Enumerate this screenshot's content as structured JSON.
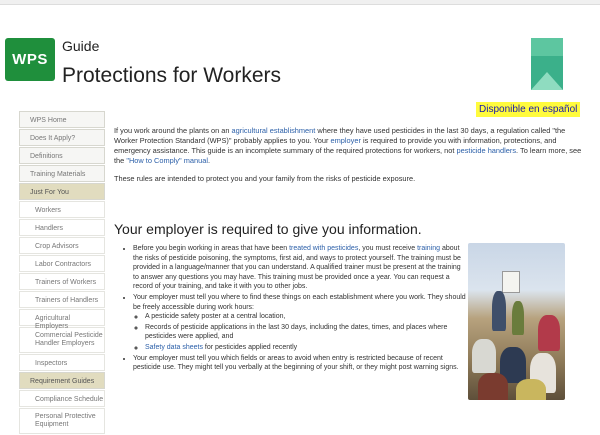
{
  "header": {
    "logo_text": "WPS",
    "guide_label": "Guide",
    "title": "Protections for Workers",
    "spanish_link": "Disponible en español"
  },
  "sidebar": {
    "items": [
      {
        "label": "WPS Home"
      },
      {
        "label": "Does It Apply?"
      },
      {
        "label": "Definitions"
      },
      {
        "label": "Training Materials"
      },
      {
        "label": "Just For You"
      },
      {
        "label": "Workers"
      },
      {
        "label": "Handlers"
      },
      {
        "label": "Crop Advisors"
      },
      {
        "label": "Labor Contractors"
      },
      {
        "label": "Trainers of Workers"
      },
      {
        "label": "Trainers of Handlers"
      },
      {
        "label": "Agricultural Employers"
      },
      {
        "label": "Commercial Pesticide Handler Employers"
      },
      {
        "label": "Inspectors"
      },
      {
        "label": "Requirement Guides"
      },
      {
        "label": "Compliance Schedule"
      },
      {
        "label": "Personal Protective Equipment"
      }
    ]
  },
  "intro": {
    "p1_a": "If you work around the plants on an ",
    "p1_link1": "agricultural establishment",
    "p1_b": " where they have used pesticides in the last 30 days, a regulation called \"the Worker Protection Standard (WPS)\" probably applies to you. Your ",
    "p1_link2": "employer",
    "p1_c": " is required to provide you with information, protections, and emergency assistance. This guide is an incomplete summary of the required protections for workers, not ",
    "p1_link3": "pesticide handlers",
    "p1_d": ". To learn more, see the ",
    "p1_link4": "\"How to Comply\" manual",
    "p1_e": ".",
    "p2_a": "These rules are intended to protect you and your family from the risks of ",
    "p2_link": "pesticide",
    "p2_b": " exposure."
  },
  "section": {
    "heading": "Your employer is required to give you information.",
    "b1_a": "Before you begin working in areas that have been ",
    "b1_link1": "treated with pesticides",
    "b1_b": ", you must receive ",
    "b1_link2": "training",
    "b1_c": " about the risks of pesticide poisoning, the symptoms, first aid, and ways to protect yourself. The training must be provided in a language/manner that you can understand. A qualified trainer must be present at the training to answer any questions you may have. This training must be provided once a year. You can request a record of your training, and take it with you to other jobs.",
    "b2": "Your employer must tell you where to find these things on each establishment where you work. They should be freely accessible during work hours:",
    "b2_sub1": "A pesticide safety poster at a central location,",
    "b2_sub2": "Records of pesticide applications in the last 30 days, including the dates, times, and places where pesticides were applied, and",
    "b2_sub3_link": "Safety data sheets",
    "b2_sub3_rest": " for pesticides applied recently",
    "b3": "Your employer must tell you which fields or areas to avoid when entry is restricted because of recent pesticide use. They might tell you verbally at the beginning of your shift, or they might post warning signs."
  },
  "icons": {
    "booklet": "booklet-cover-icon",
    "photo": "worker-training-photo"
  },
  "colors": {
    "logo_green": "#1f8f3c",
    "link_blue": "#2b5fa8",
    "highlight_yellow": "#fffb3d",
    "nav_active_bg": "#e1dcbf"
  }
}
